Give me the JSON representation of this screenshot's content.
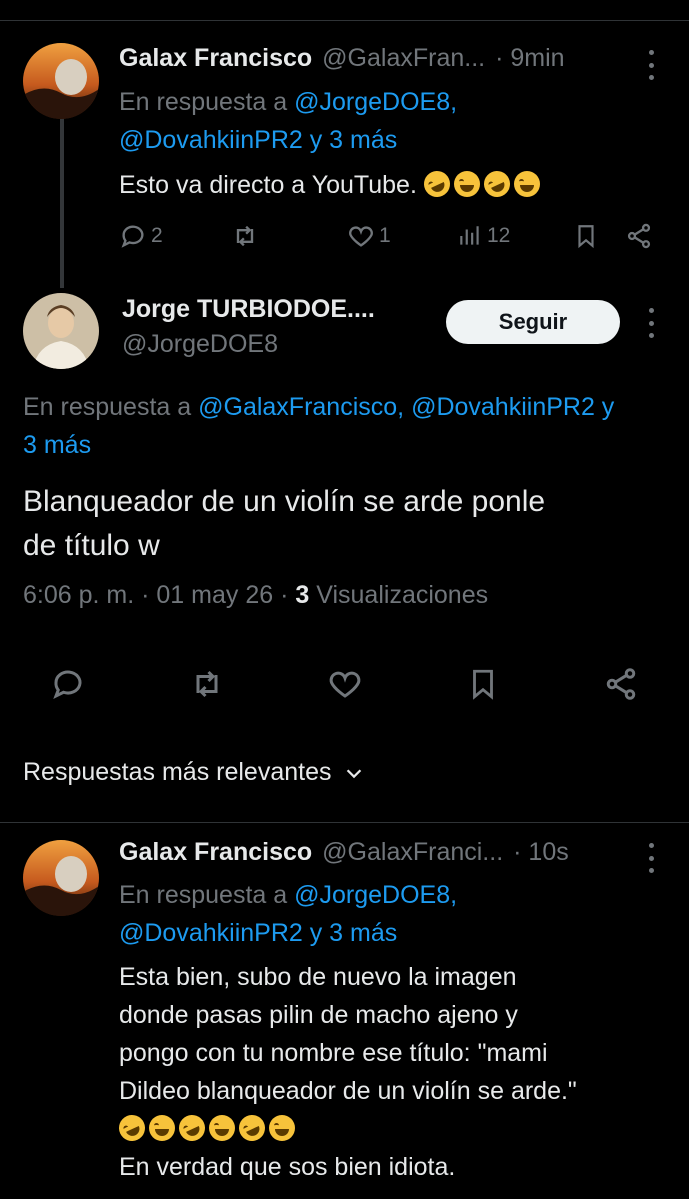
{
  "tweet1": {
    "name": "Galax Francisco",
    "handle": "@GalaxFran...",
    "time": "· 9min",
    "reply_prefix": "En respuesta a",
    "reply_to_line1": "@JorgeDOE8,",
    "reply_to_line2": "@DovahkiinPR2 y 3 más",
    "text": "Esto va directo a YouTube.",
    "emoji_count": 4,
    "replies": "2",
    "likes": "1",
    "views": "12"
  },
  "main_tweet": {
    "name": "Jorge TURBIODOE....",
    "handle": "@JorgeDOE8",
    "follow_label": "Seguir",
    "reply_prefix": "En respuesta a",
    "reply_to": "@GalaxFrancisco, @DovahkiinPR2 y",
    "reply_to_more": "3 más",
    "text_line1": "Blanqueador de un violín se arde ponle",
    "text_line2": "de título w",
    "time": "6:06 p. m.",
    "date": "01 may 26",
    "views_count": "3",
    "views_label": "Visualizaciones"
  },
  "sort": {
    "label": "Respuestas más relevantes"
  },
  "tweet2": {
    "name": "Galax Francisco",
    "handle": "@GalaxFranci...",
    "time": "· 10s",
    "reply_prefix": "En respuesta a",
    "reply_to_line1": "@JorgeDOE8,",
    "reply_to_line2": "@DovahkiinPR2 y 3 más",
    "text_line1": "Esta bien, subo de nuevo la imagen",
    "text_line2": "donde pasas pilin de macho ajeno y",
    "text_line3": "pongo con tu nombre ese título: \"mami",
    "text_line4": "Dildeo blanqueador de un violín se arde.\"",
    "text_line6": "En verdad que sos bien idiota."
  },
  "colors": {
    "background": "#000000",
    "text": "#e7e9ea",
    "muted": "#71767b",
    "link": "#1d9bf0",
    "divider": "#2f3336"
  }
}
